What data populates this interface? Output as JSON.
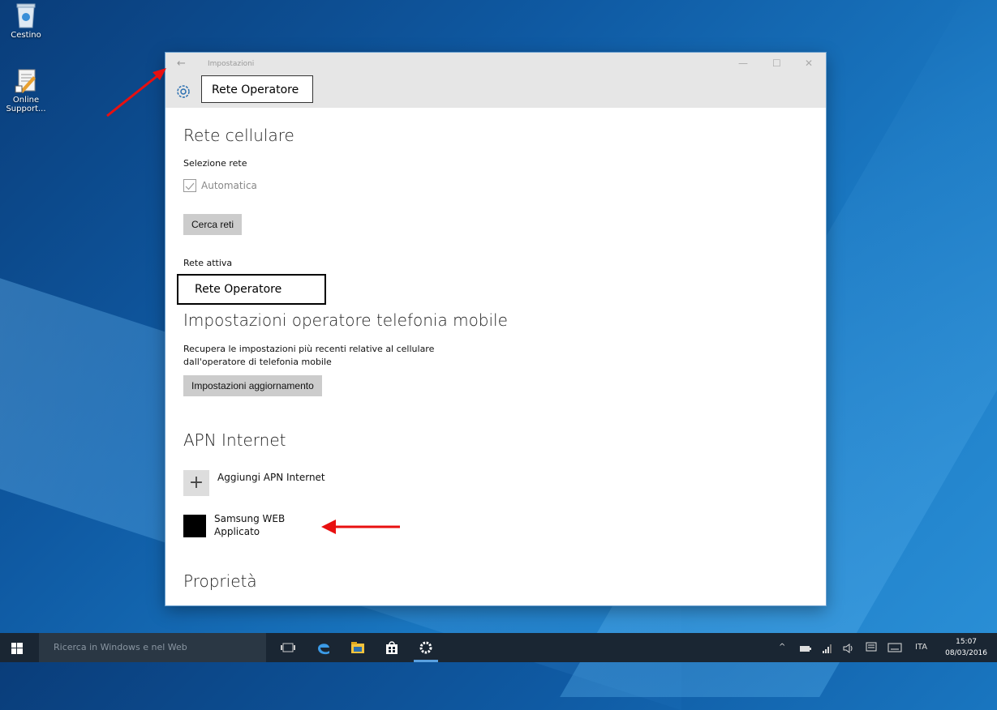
{
  "desktop": {
    "icons": [
      {
        "label": "Cestino",
        "icon": "recycle-bin-icon"
      },
      {
        "label": "Online Support...",
        "icon": "support-icon"
      }
    ]
  },
  "window": {
    "title": "Impostazioni",
    "header_box_label": "Rete Operatore",
    "controls": {
      "minimize": "—",
      "maximize": "☐",
      "close": "✕"
    },
    "back_glyph": "←"
  },
  "cellular": {
    "heading": "Rete cellulare",
    "network_selection_label": "Selezione rete",
    "automatic_label": "Automatica",
    "search_button": "Cerca reti",
    "active_network_label": "Rete attiva",
    "active_network_value": "Rete Operatore"
  },
  "operator_settings": {
    "heading": "Impostazioni operatore telefonia mobile",
    "description_line1": "Recupera le impostazioni più recenti relative al cellulare",
    "description_line2": "dall'operatore di telefonia mobile",
    "update_button": "Impostazioni aggiornamento"
  },
  "apn": {
    "heading": "APN Internet",
    "add_label": "Aggiungi APN Internet",
    "add_glyph": "+",
    "items": [
      {
        "name": "Samsung WEB",
        "status": "Applicato"
      }
    ]
  },
  "properties": {
    "heading": "Proprietà"
  },
  "taskbar": {
    "search_placeholder": "Ricerca in Windows e nel Web",
    "language": "ITA",
    "time": "15:07",
    "date": "08/03/2016",
    "tray_chevron": "^"
  },
  "colors": {
    "annotation_arrow": "#e81010",
    "taskbar_accent": "#5aa0e0"
  }
}
